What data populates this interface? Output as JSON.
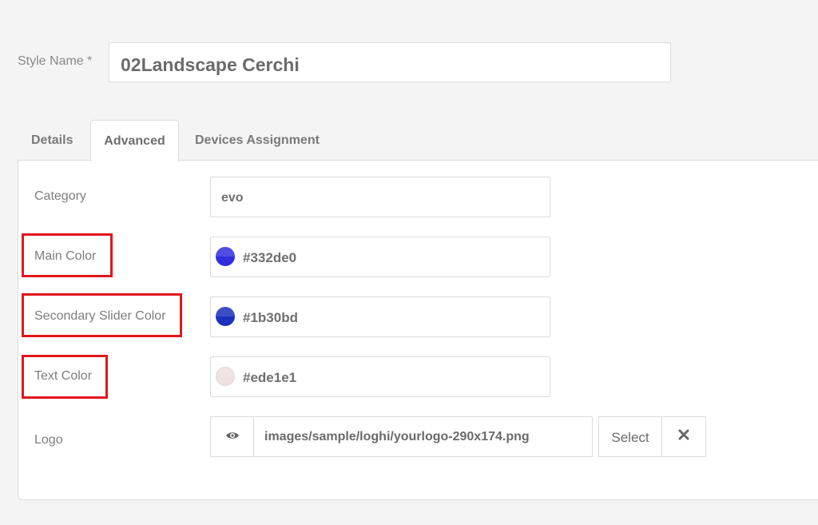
{
  "style_name": {
    "label": "Style Name *",
    "value": "02Landscape Cerchi"
  },
  "tabs": [
    {
      "label": "Details",
      "active": false
    },
    {
      "label": "Advanced",
      "active": true
    },
    {
      "label": "Devices Assignment",
      "active": false
    }
  ],
  "fields": {
    "category": {
      "label": "Category",
      "value": "evo"
    },
    "main_color": {
      "label": "Main Color",
      "value": "#332de0",
      "swatch": "#332de0"
    },
    "secondary_slider_color": {
      "label": "Secondary Slider Color",
      "value": "#1b30bd",
      "swatch": "#1b30bd"
    },
    "text_color": {
      "label": "Text Color",
      "value": "#ede1e1",
      "swatch": "#ede1e1"
    },
    "logo": {
      "label": "Logo",
      "value": "images/sample/loghi/yourlogo-290x174.png",
      "preview_icon": "eye-icon",
      "select_label": "Select",
      "clear_icon": "close-icon"
    }
  },
  "highlight_color": "#e0161c"
}
